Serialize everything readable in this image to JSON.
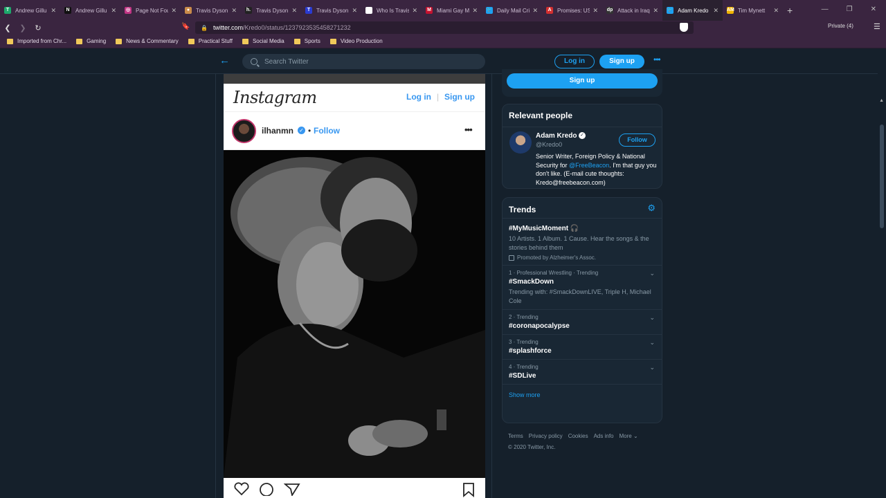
{
  "browser": {
    "tabs": [
      {
        "title": "Andrew Gillu",
        "fav_color": "#1da86b",
        "fav_char": "T"
      },
      {
        "title": "Andrew Gillu",
        "fav_color": "#111111",
        "fav_char": "N"
      },
      {
        "title": "Page Not Fou",
        "fav_color": "#c13584",
        "fav_char": "◎"
      },
      {
        "title": "Travis Dyson",
        "fav_color": "#c98b4a",
        "fav_char": "●"
      },
      {
        "title": "Travis Dyson",
        "fav_color": "#222222",
        "fav_char": "h."
      },
      {
        "title": "Travis Dyson",
        "fav_color": "#2a3bd1",
        "fav_char": "T"
      },
      {
        "title": "Who Is Travis",
        "fav_color": "#ffffff",
        "fav_char": "P"
      },
      {
        "title": "Miami Gay M",
        "fav_color": "#c4122f",
        "fav_char": "M"
      },
      {
        "title": "Daily Mail Cri",
        "fav_color": "#1da1f2",
        "fav_char": "🐦"
      },
      {
        "title": "Promises: US",
        "fav_color": "#d32f2f",
        "fav_char": "A"
      },
      {
        "title": "Attack in Iraq",
        "fav_color": "#333333",
        "fav_char": "dp"
      },
      {
        "title": "Adam Kredo",
        "fav_color": "#1da1f2",
        "fav_char": "🐦",
        "active": true
      },
      {
        "title": "Tim Mynett",
        "fav_color": "#f0b400",
        "fav_char": "AM"
      }
    ],
    "url_domain": "twitter.com",
    "url_path": "/Kredo0/status/1237923535458271232",
    "private_label": "Private (4)",
    "bookmarks": [
      "Imported from Chr...",
      "Gaming",
      "News & Commentary",
      "Practical Stuff",
      "Social Media",
      "Sports",
      "Video Production"
    ]
  },
  "twitter": {
    "search_placeholder": "Search Twitter",
    "login": "Log in",
    "signup": "Sign up",
    "accent": "#1da1f2"
  },
  "instagram": {
    "logo": "Instagram",
    "login": "Log in",
    "separator": "|",
    "signup": "Sign up",
    "username": "ilhanmn",
    "dot": "•",
    "follow": "Follow"
  },
  "sidebar": {
    "signup_button": "Sign up",
    "relevant_title": "Relevant people",
    "person": {
      "name": "Adam Kredo",
      "handle": "@Kredo0",
      "follow": "Follow",
      "bio_1": "Senior Writer, Foreign Policy & National Security for ",
      "bio_link": "@FreeBeacon",
      "bio_2": ". I'm that guy you don't like. (E-mail cute thoughts: Kredo@freebeacon.com)"
    },
    "trends_title": "Trends",
    "trends": [
      {
        "meta": "",
        "name": "#MyMusicMoment 🎧",
        "desc": "10 Artists. 1 Album. 1 Cause. Hear the songs & the stories behind them",
        "promo": "Promoted by Alzheimer's Assoc."
      },
      {
        "meta": "1 · Professional Wrestling · Trending",
        "name": "#SmackDown",
        "desc": "Trending with: #SmackDownLIVE, Triple H, Michael Cole"
      },
      {
        "meta": "2 · Trending",
        "name": "#coronapocalypse",
        "desc": ""
      },
      {
        "meta": "3 · Trending",
        "name": "#splashforce",
        "desc": ""
      },
      {
        "meta": "4 · Trending",
        "name": "#SDLive",
        "desc": ""
      }
    ],
    "show_more": "Show more",
    "footer_links": [
      "Terms",
      "Privacy policy",
      "Cookies",
      "Ads info",
      "More ⌄"
    ],
    "copyright": "© 2020 Twitter, Inc."
  }
}
